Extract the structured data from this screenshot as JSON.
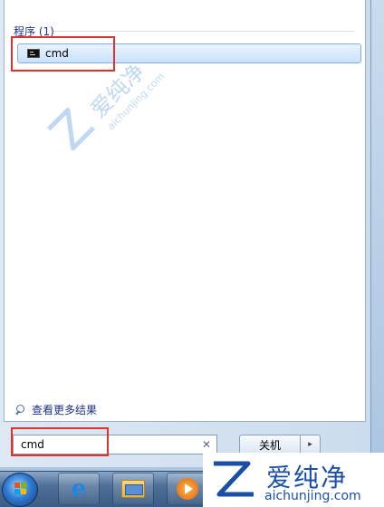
{
  "start_menu": {
    "group_header": "程序 (1)",
    "results": [
      {
        "label": "cmd",
        "icon": "command-prompt-icon"
      }
    ],
    "see_more": "查看更多结果",
    "search": {
      "value": "cmd"
    },
    "shutdown_label": "关机",
    "shutdown_arrow": "▸"
  },
  "taskbar": {
    "items": [
      "internet-explorer-icon",
      "library-folder-icon",
      "media-player-icon"
    ]
  },
  "watermark": {
    "text": "爱纯净",
    "url": "aichunjing.com"
  },
  "brand_logo": {
    "title": "爱纯净",
    "url": "aichunjing.com"
  },
  "colors": {
    "highlight": "#e0322a",
    "link_blue": "#1e3287",
    "brand_blue": "#1a4fa8"
  }
}
